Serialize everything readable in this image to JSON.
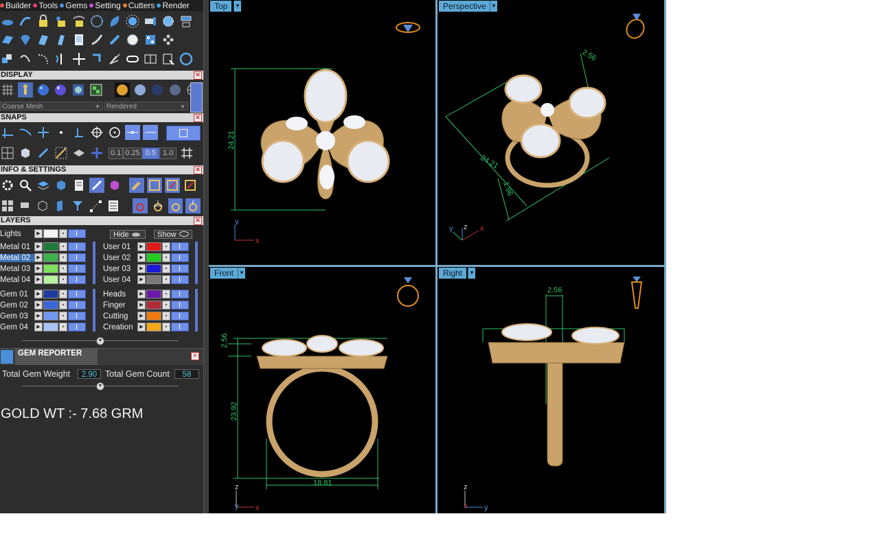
{
  "menu": {
    "items": [
      {
        "label": "Builder",
        "dot": "#e05050"
      },
      {
        "label": "Tools",
        "dot": "#e04070"
      },
      {
        "label": "Gems",
        "dot": "#4a90e0"
      },
      {
        "label": "Setting",
        "dot": "#c04fd0"
      },
      {
        "label": "Cutters",
        "dot": "#e08030"
      },
      {
        "label": "Render",
        "dot": "#40a0e0"
      }
    ]
  },
  "display": {
    "title": "DISPLAY",
    "mesh_mode": "Coarse Mesh",
    "render_mode": "Rendered"
  },
  "snaps": {
    "title": "SNAPS",
    "values": [
      "0.1",
      "0.25",
      "0.5",
      "1.0"
    ]
  },
  "info": {
    "title": "INFO & SETTINGS"
  },
  "layers": {
    "title": "LAYERS",
    "lights_label": "Lights",
    "hide_label": "Hide",
    "show_label": "Show",
    "left": [
      {
        "name": "Metal 01",
        "color": "#1f7a3a"
      },
      {
        "name": "Metal 02",
        "color": "#3cb04a",
        "selected": true
      },
      {
        "name": "Metal 03",
        "color": "#7ee05a"
      },
      {
        "name": "Metal 04",
        "color": "#b7f0a0"
      },
      {
        "name": "Gem 01",
        "color": "#1d3b9c"
      },
      {
        "name": "Gem 02",
        "color": "#3a66d8"
      },
      {
        "name": "Gem 03",
        "color": "#6f97f0"
      },
      {
        "name": "Gem 04",
        "color": "#a9c3f5"
      }
    ],
    "right": [
      {
        "name": "User 01",
        "color": "#e01a1a"
      },
      {
        "name": "User 02",
        "color": "#22cc22"
      },
      {
        "name": "User 03",
        "color": "#1a1ad8"
      },
      {
        "name": "User 04",
        "color": "#7a7a7a"
      },
      {
        "name": "Heads",
        "color": "#6a1aa8"
      },
      {
        "name": "Finger",
        "color": "#b02a3a"
      },
      {
        "name": "Cutting",
        "color": "#f07a10"
      },
      {
        "name": "Creation",
        "color": "#f2a81a"
      }
    ]
  },
  "gem_reporter": {
    "title": "GEM REPORTER",
    "weight_label": "Total Gem Weight",
    "weight_value": "2.90",
    "count_label": "Total Gem Count",
    "count_value": "58"
  },
  "note": "GOLD WT :- 7.68 GRM",
  "viewports": {
    "top": {
      "label": "Top",
      "dim_v": "24.21",
      "axis_v": "y",
      "axis_h": "x"
    },
    "perspective": {
      "label": "Perspective",
      "dim_a": "24.21",
      "dim_b": "2.56",
      "dim_c": "1.96",
      "axis_v": "z",
      "axis_h": "x",
      "axis_d": "y"
    },
    "front": {
      "label": "Front",
      "dim_v": "23.92",
      "dim_h": "18.81",
      "dim_s": "2.56",
      "axis_v": "z",
      "axis_h": "x",
      "axis_d": "y"
    },
    "right": {
      "label": "Right",
      "dim_t": "2.56",
      "axis_v": "z",
      "axis_h": "y",
      "axis_d": "x"
    }
  },
  "colors": {
    "accent": "#5da9d6",
    "metal": "#c9a36a",
    "dimension": "#2fc468",
    "orientation": "#e08b1a"
  }
}
